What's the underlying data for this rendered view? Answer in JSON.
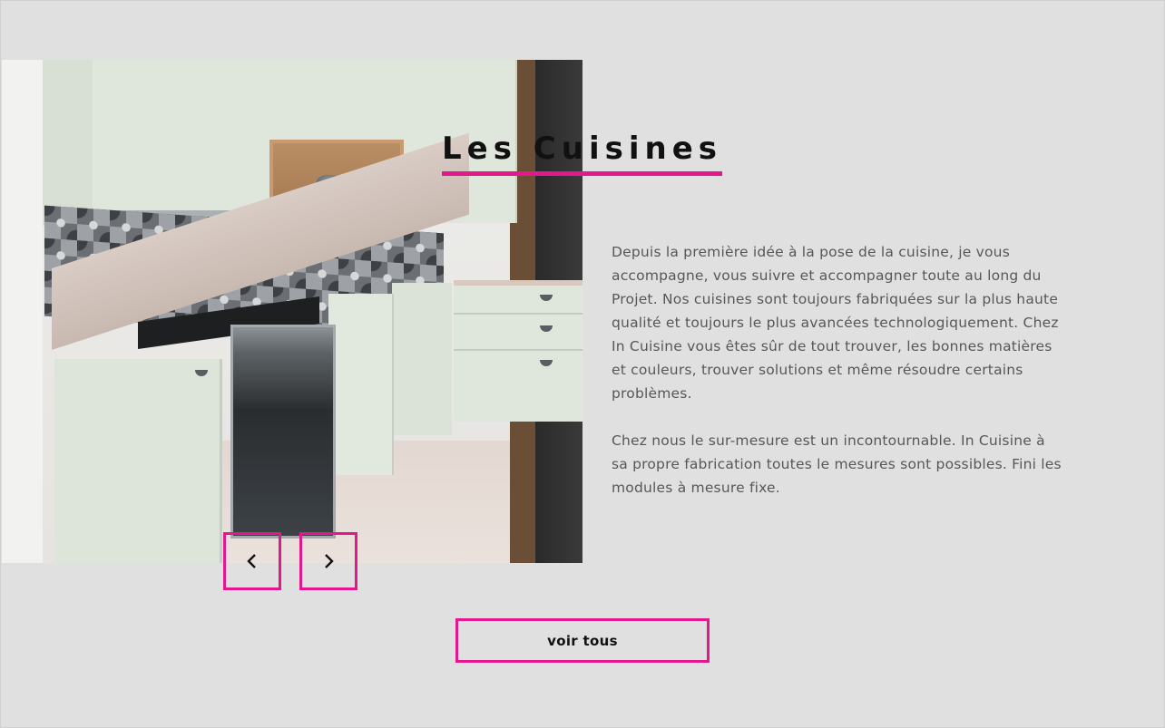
{
  "section": {
    "title": "Les Cuisines",
    "paragraphs": [
      "Depuis la première idée à la pose de la cuisine, je vous accompagne, vous suivre et accompagner toute au long du Projet. Nos cuisines sont toujours fabriquées sur la plus haute qualité et toujours le plus avancées technologiquement. Chez In Cuisine vous êtes sûr de tout trouver, les bonnes matières et couleurs, trouver solutions et même résoudre certains problèmes.",
      "Chez nous le sur-mesure est un incontournable. In Cuisine à sa propre fabrication toutes le mesures sont possibles. Fini les modules à mesure fixe."
    ],
    "button_label": "voir tous"
  },
  "carousel": {
    "prev_icon": "chevron-left-icon",
    "next_icon": "chevron-right-icon"
  },
  "colors": {
    "accent": "#e3188d",
    "background": "#e0e0e0",
    "text": "#575757",
    "heading": "#111111"
  }
}
